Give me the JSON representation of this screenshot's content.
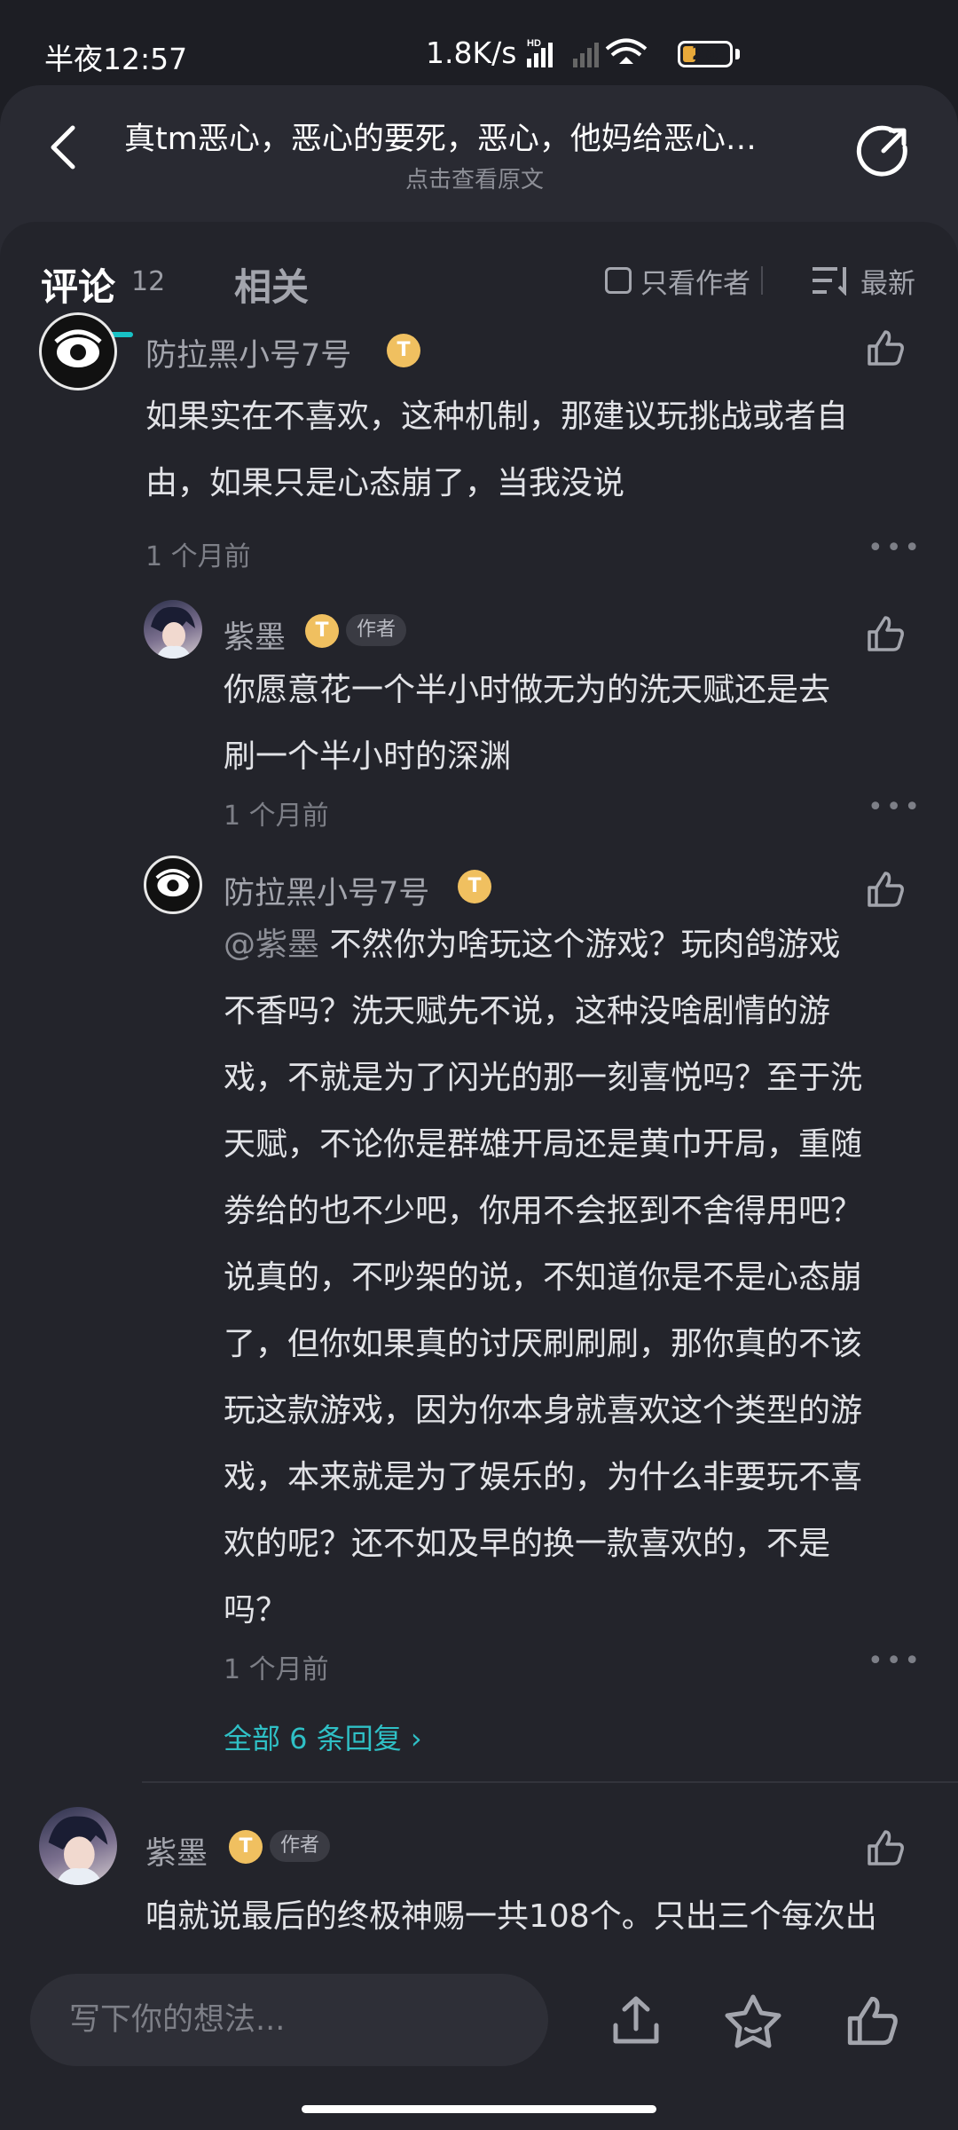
{
  "status_bar": {
    "time": "半夜12:57",
    "network_speed": "1.8K/s",
    "battery_level": "28",
    "battery_percent": 28
  },
  "header": {
    "title": "真tm恶心，恶心的要死，恶心，他妈给恶心…",
    "subtitle": "点击查看原文"
  },
  "tabs": {
    "comments_label": "评论",
    "comments_count": "12",
    "related_label": "相关",
    "author_only_label": "只看作者",
    "sort_label": "最新"
  },
  "comments": [
    {
      "user": "防拉黑小号7号",
      "lines": [
        "如果实在不喜欢，这种机制，那建议玩挑战或者自",
        "由，如果只是心态崩了，当我没说"
      ],
      "time": "1 个月前",
      "replies": [
        {
          "user": "紫墨",
          "tag": "作者",
          "lines": [
            "你愿意花一个半小时做无为的洗天赋还是去",
            "刷一个半小时的深渊"
          ],
          "time": "1 个月前"
        },
        {
          "user": "防拉黑小号7号",
          "mention": "@紫墨",
          "lines": [
            "不然你为啥玩这个游戏？玩肉鸽游戏",
            "不香吗？洗天赋先不说，这种没啥剧情的游",
            "戏，不就是为了闪光的那一刻喜悦吗？至于洗",
            "天赋，不论你是群雄开局还是黄巾开局，重随",
            "劵给的也不少吧，你用不会抠到不舍得用吧？",
            "说真的，不吵架的说，不知道你是不是心态崩",
            "了，但你如果真的讨厌刷刷刷，那你真的不该",
            "玩这款游戏，因为你本身就喜欢这个类型的游",
            "戏，本来就是为了娱乐的，为什么非要玩不喜",
            "欢的呢？还不如及早的换一款喜欢的，不是",
            "吗？"
          ],
          "time": "1 个月前"
        }
      ],
      "view_all_replies": "全部 6 条回复"
    },
    {
      "user": "紫墨",
      "tag": "作者",
      "lines": [
        "咱就说最后的终极神赐一共108个。只出三个每次出"
      ]
    }
  ],
  "level_badge": "T",
  "bottom_bar": {
    "input_placeholder": "写下你的想法..."
  },
  "colors": {
    "accent": "#18c2c6",
    "link": "#2fc0c6",
    "badge": "#f0c060",
    "background": "#23242b"
  }
}
